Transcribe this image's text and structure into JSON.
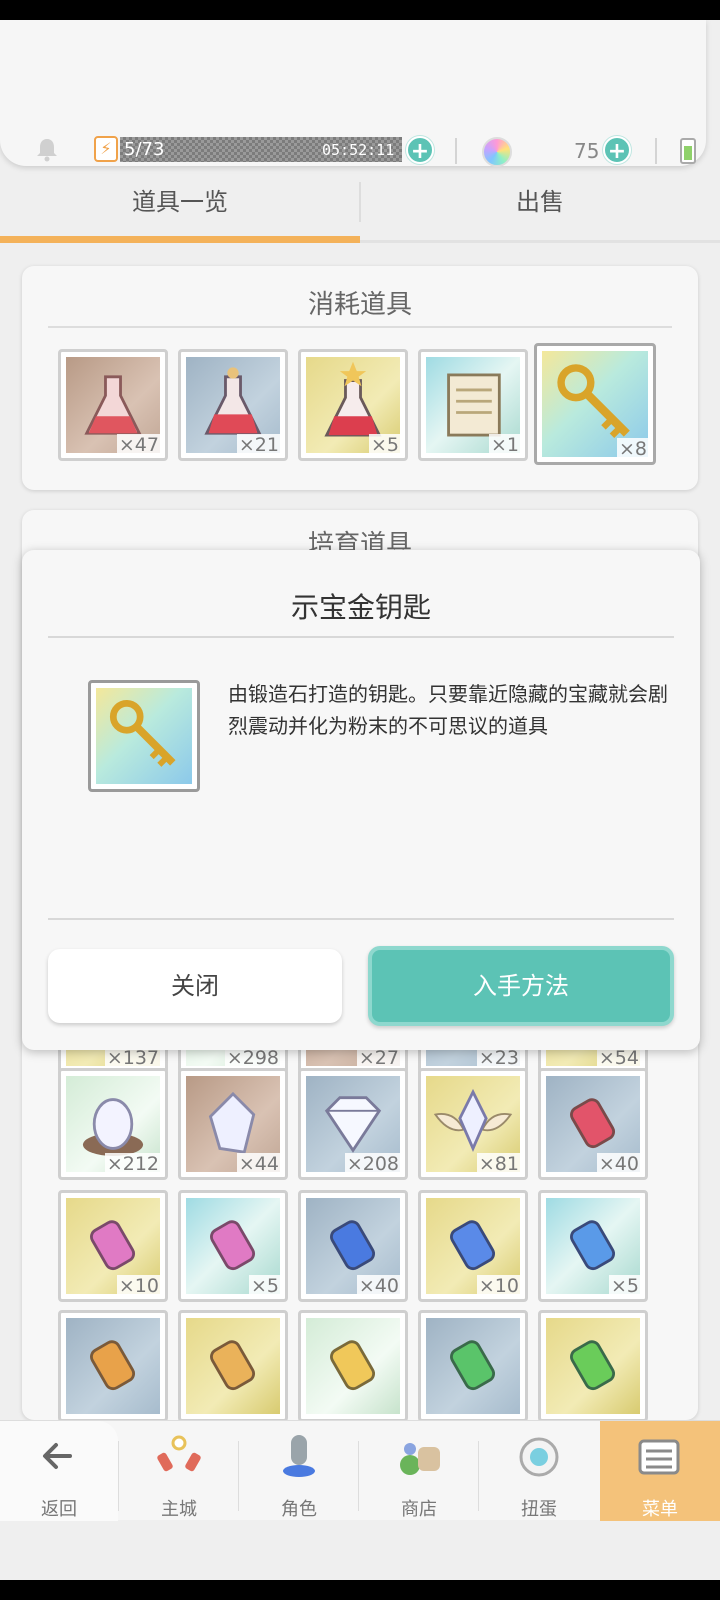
{
  "header": {
    "stamina": "5/73",
    "stamina_timer": "05:52:11",
    "gems": "75"
  },
  "tabs": [
    {
      "label": "道具一览",
      "active": true
    },
    {
      "label": "出售",
      "active": false
    }
  ],
  "consumables": {
    "title": "消耗道具",
    "items": [
      {
        "icon": "red-potion-icon",
        "count": "×47"
      },
      {
        "icon": "red-potion-icon",
        "count": "×21"
      },
      {
        "icon": "red-potion-icon",
        "count": "×5"
      },
      {
        "icon": "scroll-icon",
        "count": "×1"
      },
      {
        "icon": "golden-key-icon",
        "count": "×8"
      }
    ]
  },
  "materials": {
    "title": "培育道具",
    "rows": [
      [
        {
          "icon": "material-icon",
          "count": "×137"
        },
        {
          "icon": "material-icon",
          "count": "×298"
        },
        {
          "icon": "material-icon",
          "count": "×27"
        },
        {
          "icon": "material-icon",
          "count": "×23"
        },
        {
          "icon": "material-icon",
          "count": "×54"
        }
      ],
      [
        {
          "icon": "crystal-egg-icon",
          "count": "×212"
        },
        {
          "icon": "crystal-shard-icon",
          "count": "×44"
        },
        {
          "icon": "diamond-icon",
          "count": "×208"
        },
        {
          "icon": "winged-crystal-icon",
          "count": "×81"
        },
        {
          "icon": "red-tube-icon",
          "count": "×40"
        }
      ],
      [
        {
          "icon": "pink-tube-icon",
          "count": "×10"
        },
        {
          "icon": "pink-tube-icon",
          "count": "×5"
        },
        {
          "icon": "blue-tube-icon",
          "count": "×40"
        },
        {
          "icon": "blue-tube-icon",
          "count": "×10"
        },
        {
          "icon": "blue-tube-icon",
          "count": "×5"
        }
      ],
      [
        {
          "icon": "orange-tube-icon",
          "count": ""
        },
        {
          "icon": "orange-tube-icon",
          "count": ""
        },
        {
          "icon": "yellow-tube-icon",
          "count": ""
        },
        {
          "icon": "green-tube-icon",
          "count": ""
        },
        {
          "icon": "green-tube-icon",
          "count": ""
        }
      ]
    ]
  },
  "dialog": {
    "title": "示宝金钥匙",
    "description": "由锻造石打造的钥匙。只要靠近隐藏的宝藏就会剧烈震动并化为粉末的不可思议的道具",
    "close_label": "关闭",
    "obtain_label": "入手方法"
  },
  "nav": [
    {
      "label": "返回",
      "icon": "back-arrow-icon"
    },
    {
      "label": "主城",
      "icon": "castle-icon"
    },
    {
      "label": "角色",
      "icon": "character-icon"
    },
    {
      "label": "商店",
      "icon": "shop-icon"
    },
    {
      "label": "扭蛋",
      "icon": "gacha-icon"
    },
    {
      "label": "菜单",
      "icon": "menu-icon",
      "active": true
    }
  ],
  "colors": {
    "accent_teal": "#5cc3b5",
    "tab_orange": "#f4b25a",
    "menu_orange": "#f4c27a"
  }
}
